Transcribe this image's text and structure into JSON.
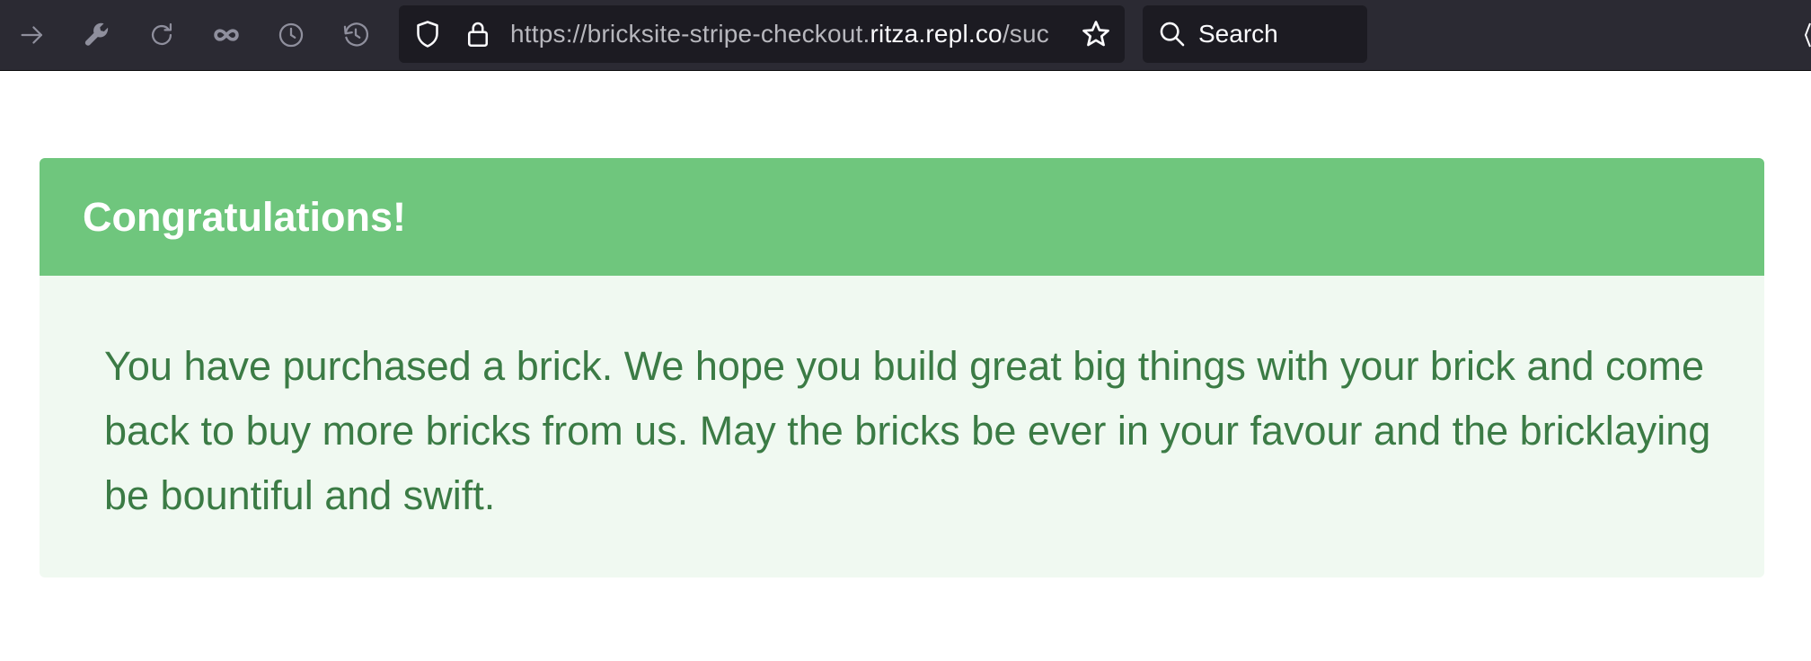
{
  "browser": {
    "url": {
      "prefix": "https://bricksite-stripe-checkout.",
      "host": "ritza.repl.co",
      "path": "/suc"
    },
    "search_label": "Search",
    "icons": {
      "forward": "arrow-right-icon",
      "tools": "wrench-icon",
      "reload": "reload-icon",
      "infinity": "infinity-icon",
      "clock": "clock-icon",
      "history": "history-icon",
      "shield": "shield-icon",
      "lock": "lock-icon",
      "bookmark": "star-icon",
      "search": "search-icon"
    },
    "colors": {
      "toolbar": "#2b2a33",
      "field": "#1c1b22"
    }
  },
  "alert": {
    "title": "Congratulations!",
    "message": "You have purchased a brick. We hope you build great big things with your brick and come back to buy more bricks from us. May the bricks be ever in your favour and the bricklaying be bountiful and swift.",
    "colors": {
      "header": "#6fc67d",
      "body_bg": "#f0f9f1",
      "body_text": "#3b7b45"
    }
  }
}
